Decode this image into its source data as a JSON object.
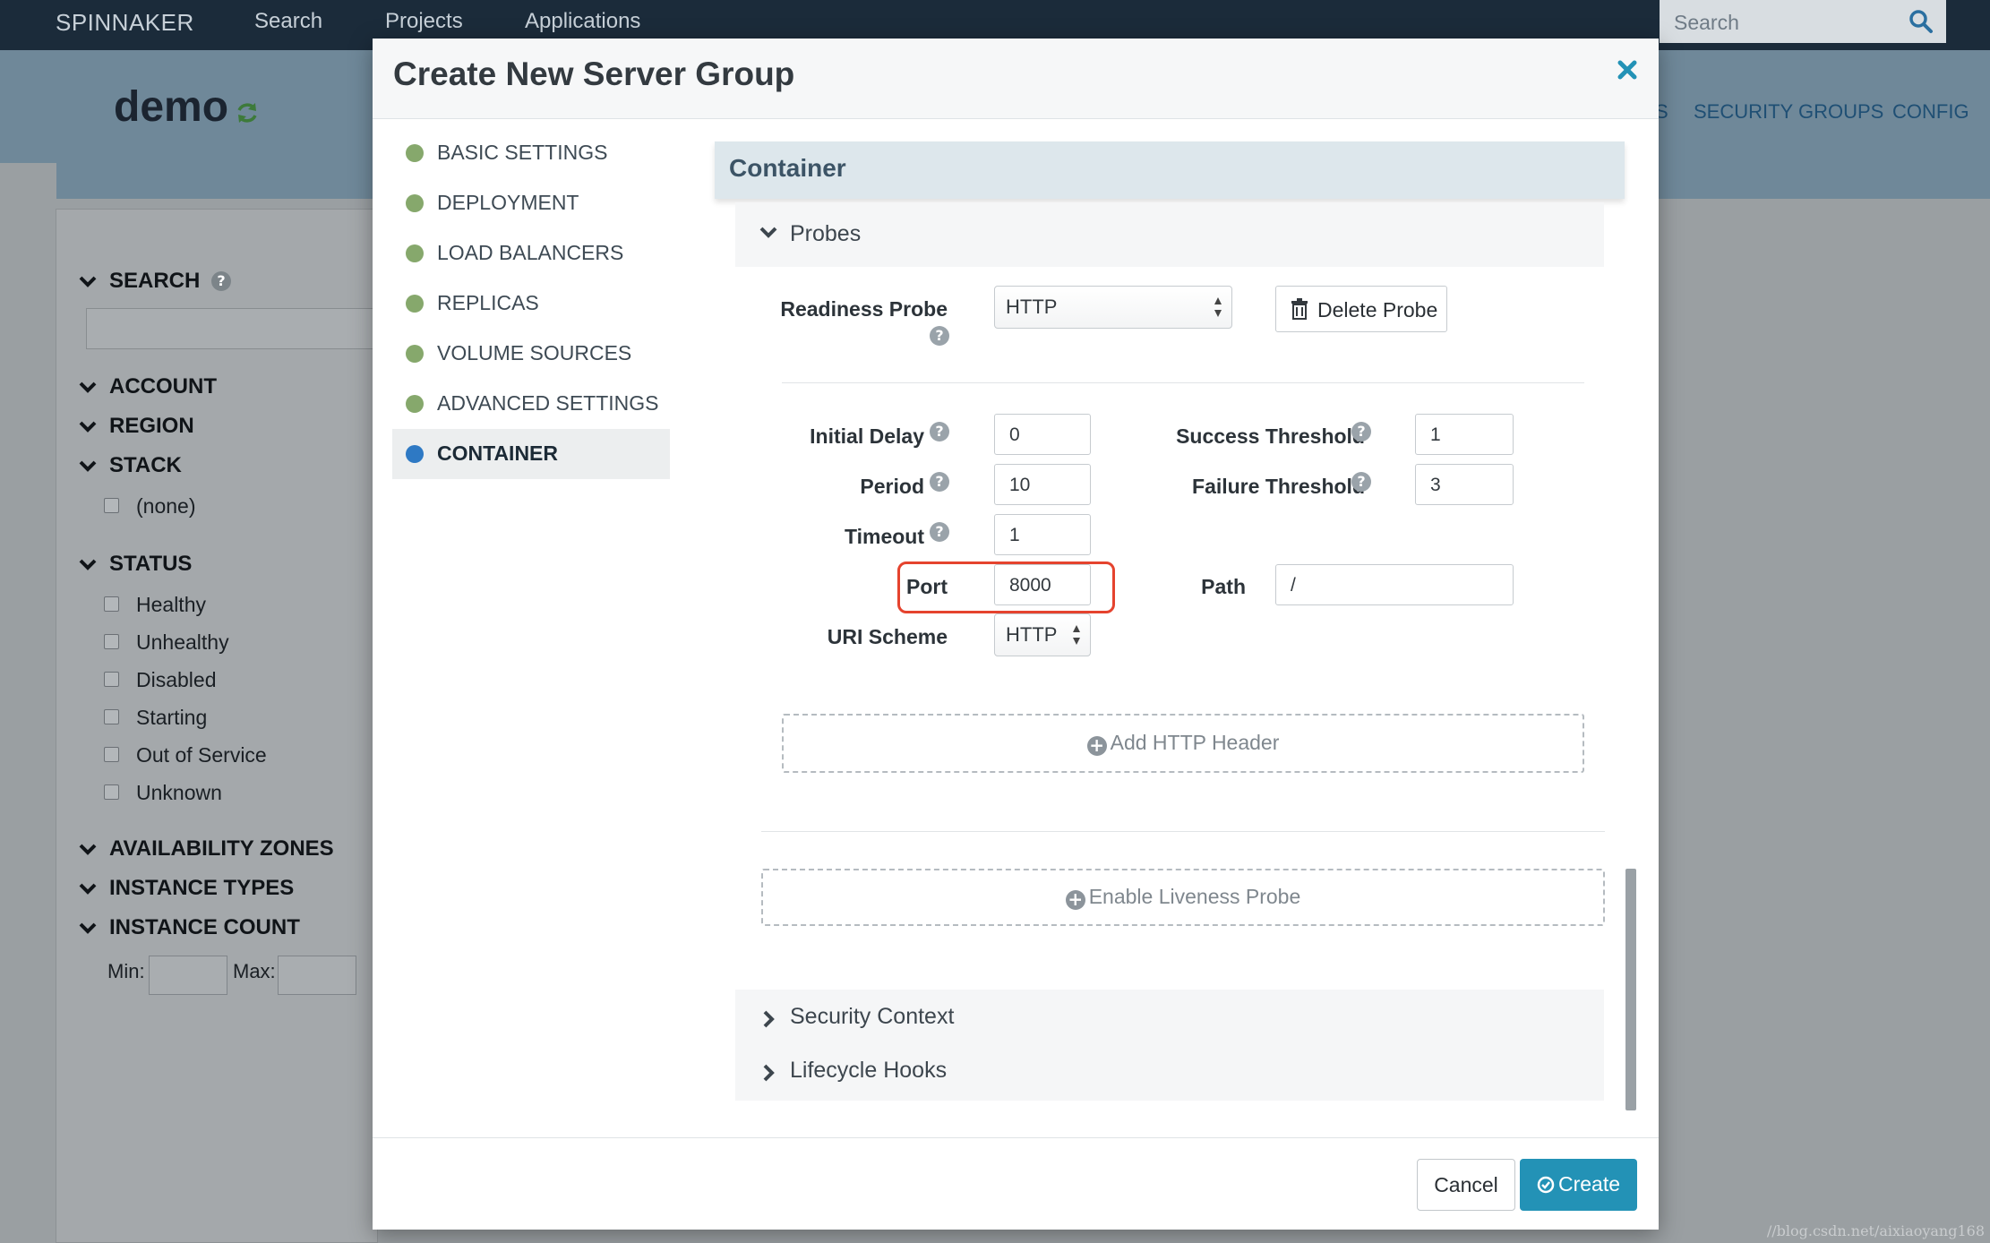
{
  "topnav": {
    "brand": "SPINNAKER",
    "links": [
      "Search",
      "Projects",
      "Applications"
    ],
    "search_placeholder": "Search"
  },
  "app": {
    "name": "demo",
    "tabs_right": [
      "S",
      "SECURITY GROUPS",
      "CONFIG"
    ]
  },
  "filters": {
    "search_heading": "SEARCH",
    "sections": [
      "ACCOUNT",
      "REGION",
      "STACK"
    ],
    "stack_options": [
      "(none)"
    ],
    "status_heading": "STATUS",
    "status_options": [
      "Healthy",
      "Unhealthy",
      "Disabled",
      "Starting",
      "Out of Service",
      "Unknown"
    ],
    "bottom_sections": [
      "AVAILABILITY ZONES",
      "INSTANCE TYPES",
      "INSTANCE COUNT"
    ],
    "min_label": "Min:",
    "max_label": "Max:"
  },
  "modal": {
    "title": "Create New Server Group",
    "nav": [
      "BASIC SETTINGS",
      "DEPLOYMENT",
      "LOAD BALANCERS",
      "REPLICAS",
      "VOLUME SOURCES",
      "ADVANCED SETTINGS",
      "CONTAINER"
    ],
    "active_nav": "CONTAINER",
    "section_title": "Container",
    "probes": {
      "title": "Probes",
      "readiness_label": "Readiness Probe",
      "readiness_value": "HTTP",
      "delete_label": "Delete Probe",
      "initial_delay_label": "Initial Delay",
      "initial_delay": "0",
      "period_label": "Period",
      "period": "10",
      "timeout_label": "Timeout",
      "timeout": "1",
      "port_label": "Port",
      "port": "8000",
      "uri_scheme_label": "URI Scheme",
      "uri_scheme": "HTTP",
      "success_threshold_label": "Success Threshold",
      "success_threshold": "1",
      "failure_threshold_label": "Failure Threshold",
      "failure_threshold": "3",
      "path_label": "Path",
      "path": "/",
      "add_header_label": "Add HTTP Header",
      "enable_liveness_label": "Enable Liveness Probe"
    },
    "collapsed": [
      "Security Context",
      "Lifecycle Hooks"
    ],
    "cancel_label": "Cancel",
    "create_label": "Create"
  },
  "watermark": "//blog.csdn.net/aixiaoyang168",
  "colors": {
    "accent": "#2392b6",
    "highlight": "#e5432e",
    "complete_dot": "#86a86c",
    "active_dot": "#2e79c4"
  }
}
